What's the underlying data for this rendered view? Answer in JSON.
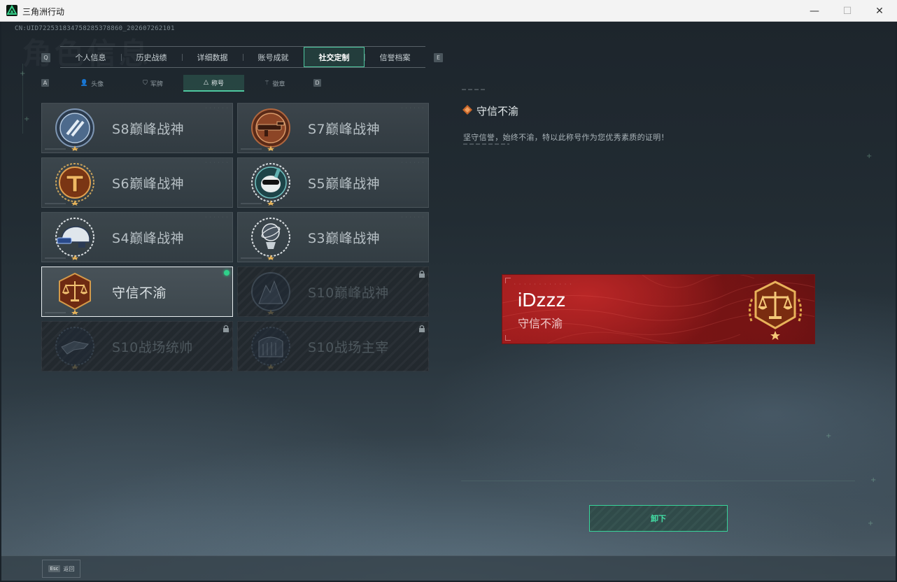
{
  "window": {
    "title": "三角洲行动",
    "minimize": "—",
    "maximize": "☐",
    "close": "✕"
  },
  "watermark": "角色信息",
  "cnuid": "CN:UID722531834758285378860_202607262101",
  "main_tabs": {
    "prev_key": "Q",
    "next_key": "E",
    "items": [
      {
        "label": "个人信息",
        "active": false
      },
      {
        "label": "历史战绩",
        "active": false
      },
      {
        "label": "详细数据",
        "active": false
      },
      {
        "label": "账号成就",
        "active": false
      },
      {
        "label": "社交定制",
        "active": true
      },
      {
        "label": "信誉档案",
        "active": false
      }
    ]
  },
  "sub_tabs": {
    "prev_key": "A",
    "next_key": "D",
    "items": [
      {
        "label": "头像",
        "icon": "person-icon",
        "active": false
      },
      {
        "label": "军牌",
        "icon": "dogtag-icon",
        "active": false
      },
      {
        "label": "称号",
        "icon": "triangle-icon",
        "active": true
      },
      {
        "label": "徽章",
        "icon": "emblem-icon",
        "active": false
      }
    ]
  },
  "titles": [
    {
      "label": "S8巅峰战神",
      "badge": "s8-badge-icon",
      "state": "normal"
    },
    {
      "label": "S7巅峰战神",
      "badge": "s7-badge-icon",
      "state": "normal"
    },
    {
      "label": "S6巅峰战神",
      "badge": "s6-badge-icon",
      "state": "normal"
    },
    {
      "label": "S5巅峰战神",
      "badge": "s5-badge-icon",
      "state": "normal"
    },
    {
      "label": "S4巅峰战神",
      "badge": "s4-badge-icon",
      "state": "normal"
    },
    {
      "label": "S3巅峰战神",
      "badge": "s3-badge-icon",
      "state": "normal"
    },
    {
      "label": "守信不渝",
      "badge": "scales-badge-icon",
      "state": "selected"
    },
    {
      "label": "S10巅峰战神",
      "badge": "s10-peak-badge-icon",
      "state": "locked"
    },
    {
      "label": "S10战场统帅",
      "badge": "s10-commander-badge-icon",
      "state": "locked"
    },
    {
      "label": "S10战场主宰",
      "badge": "s10-dominator-badge-icon",
      "state": "locked"
    }
  ],
  "detail": {
    "title": "守信不渝",
    "description": "坚守信誉，始终不渝，特以此称号作为您优秀素质的证明！"
  },
  "nameplate": {
    "player_name": "iDzzz",
    "title": "守信不渝"
  },
  "unequip_button": "卸下",
  "footer": {
    "esc_key": "Esc",
    "esc_label": "返回"
  },
  "colors": {
    "accent": "#4fc8a0",
    "equipped": "#2fd18a",
    "nameplate_red": "#9c1b1c",
    "badge_gold": "#c8862e"
  }
}
